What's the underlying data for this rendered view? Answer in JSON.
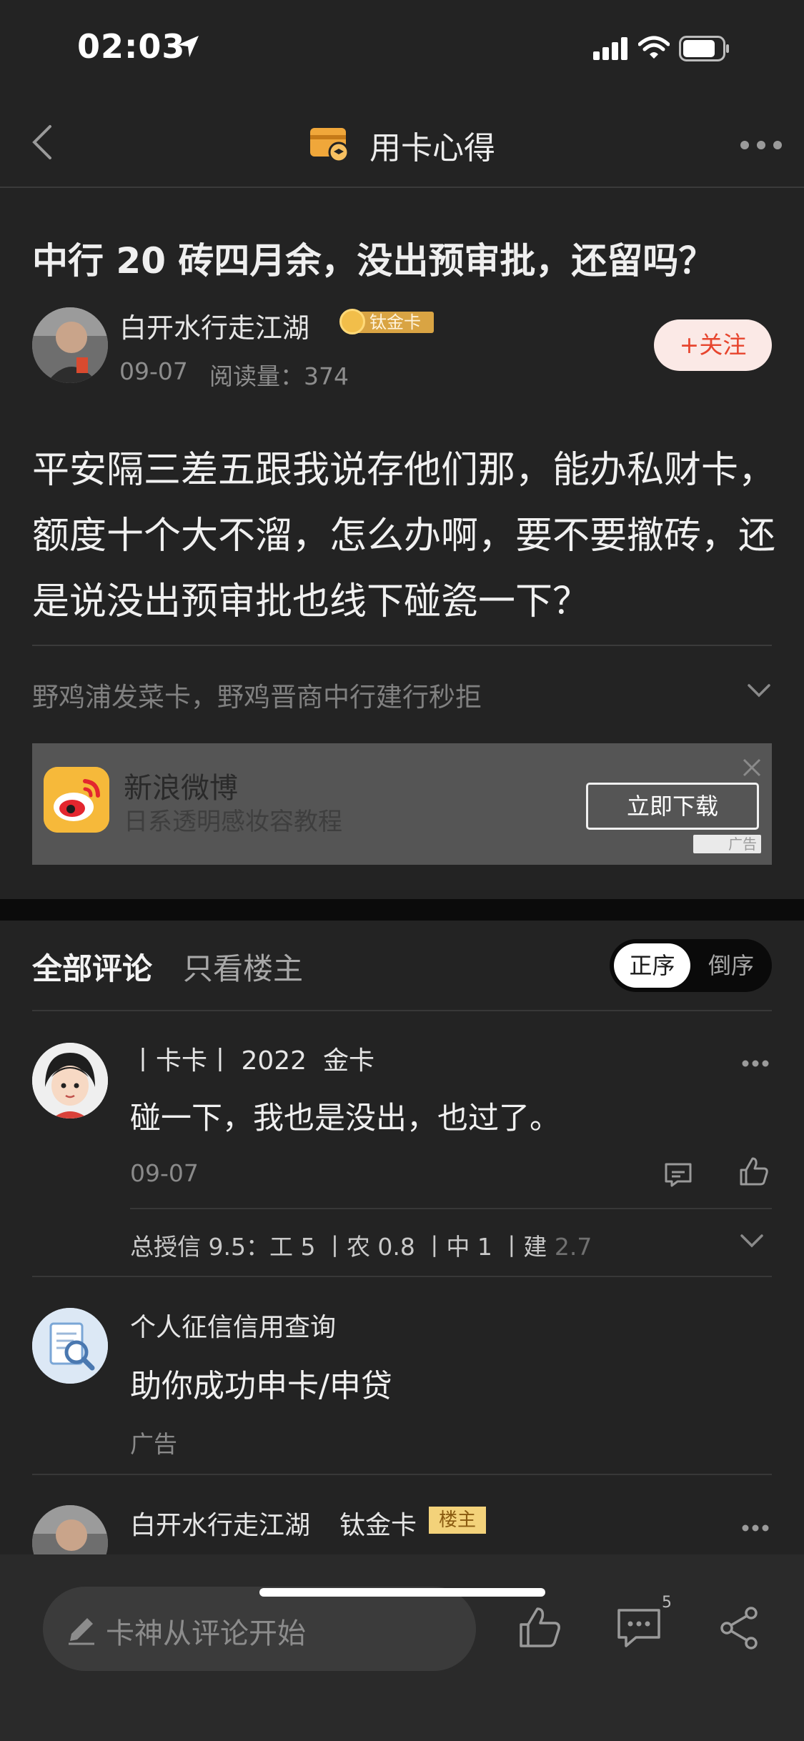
{
  "status_bar": {
    "time": "02:03"
  },
  "nav": {
    "title": "用卡心得"
  },
  "post": {
    "title": "中行 20 砖四月余，没出预审批，还留吗？",
    "author": "白开水行走江湖",
    "author_badge": "钛金卡",
    "date": "09-07",
    "reads": "阅读量：374",
    "follow_label": "+关注",
    "body": "平安隔三差五跟我说存他们那，能办私财卡，额度十个大不溜，怎么办啊，要不要撤砖，还是说没出预审批也线下碰瓷一下？",
    "signature": "野鸡浦发菜卡，野鸡晋商中行建行秒拒"
  },
  "ad": {
    "title": "新浪微博",
    "subtitle": "日系透明感妆容教程",
    "button": "立即下载",
    "mark": "广告"
  },
  "comments_header": {
    "tab_all": "全部评论",
    "tab_op": "只看楼主",
    "sort_asc": "正序",
    "sort_desc": "倒序"
  },
  "comments": [
    {
      "name": "丨卡卡丨 2022  金卡",
      "text": "碰一下，我也是没出，也过了。",
      "date": "09-07",
      "signature_main": "总授信 9.5：工 5 丨农 0.8 丨中 1 丨建 ",
      "signature_fade": "2.7"
    },
    {
      "name": "个人征信信用查询",
      "text": "助你成功申卡/申贷",
      "ad_label": "广告"
    },
    {
      "name": "白开水行走江湖",
      "level": "钛金卡",
      "op_badge": "楼主"
    }
  ],
  "bottom_bar": {
    "placeholder": "卡神从评论开始",
    "comment_count": "5"
  },
  "colors": {
    "background": "#232323",
    "accent_orange": "#f0a73a",
    "follow_red": "#e7452e",
    "follow_bg": "#fbe9e6"
  }
}
